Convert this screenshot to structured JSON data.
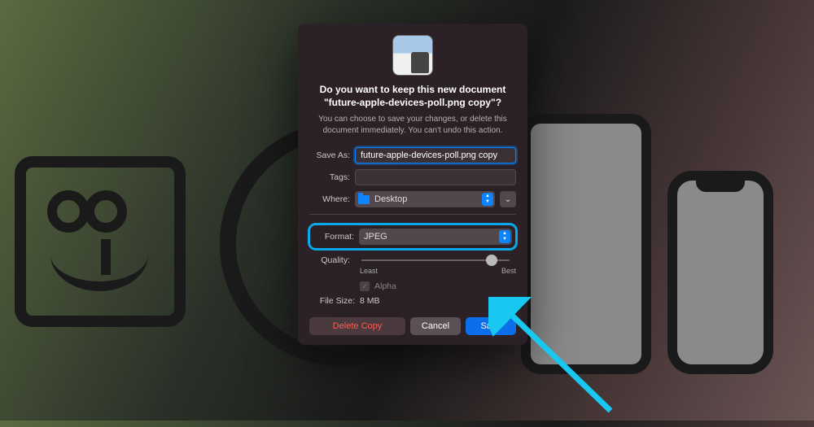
{
  "dialog": {
    "heading_line1": "Do you want to keep this new document",
    "heading_line2": "\"future-apple-devices-poll.png copy\"?",
    "subtext": "You can choose to save your changes, or delete this document immediately. You can't undo this action.",
    "save_as": {
      "label": "Save As:",
      "value": "future-apple-devices-poll.png copy"
    },
    "tags": {
      "label": "Tags:",
      "value": ""
    },
    "where": {
      "label": "Where:",
      "value": "Desktop"
    },
    "format": {
      "label": "Format:",
      "value": "JPEG"
    },
    "quality": {
      "label": "Quality:",
      "least_label": "Least",
      "best_label": "Best",
      "position_percent": 88
    },
    "alpha": {
      "label": "Alpha",
      "checked": true,
      "enabled": false
    },
    "file_size": {
      "label": "File Size:",
      "value": "8 MB"
    },
    "buttons": {
      "delete": "Delete Copy",
      "cancel": "Cancel",
      "save": "Save"
    }
  }
}
